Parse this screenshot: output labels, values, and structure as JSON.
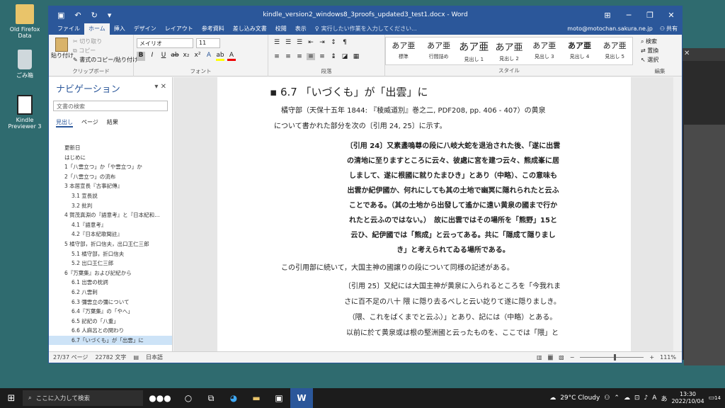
{
  "desktop": {
    "icons": [
      {
        "label": "Old Firefox Data"
      },
      {
        "label": "ごみ箱"
      },
      {
        "label": "Kindle Previewer 3"
      }
    ]
  },
  "window": {
    "title": "kindle_version2_windows8_3proofs_updated3_test1.docx - Word",
    "user": "moto@motochan.sakura.ne.jp",
    "share": "共有"
  },
  "tabs": [
    "ファイル",
    "ホーム",
    "挿入",
    "デザイン",
    "レイアウト",
    "参考資料",
    "差し込み文書",
    "校閲",
    "表示"
  ],
  "tell_me": "実行したい作業を入力してください...",
  "ribbon": {
    "clipboard": {
      "label": "クリップボード",
      "paste": "貼り付け",
      "cut": "切り取り",
      "copy": "コピー",
      "format_paint": "書式のコピー/貼り付け"
    },
    "font": {
      "label": "フォント",
      "name": "メイリオ",
      "size": "11"
    },
    "paragraph": {
      "label": "段落"
    },
    "styles": {
      "label": "スタイル",
      "items": [
        {
          "sample": "あア亜",
          "name": "標準"
        },
        {
          "sample": "あア亜",
          "name": "行間詰め"
        },
        {
          "sample": "あア亜",
          "name": "見出し 1"
        },
        {
          "sample": "あア亜",
          "name": "見出し 2"
        },
        {
          "sample": "あア亜",
          "name": "見出し 3"
        },
        {
          "sample": "あア亜",
          "name": "見出し 4"
        },
        {
          "sample": "あア亜",
          "name": "見出し 5"
        }
      ]
    },
    "editing": {
      "label": "編集",
      "find": "検索",
      "replace": "置換",
      "select": "選択"
    }
  },
  "nav": {
    "title": "ナビゲーション",
    "search_placeholder": "文書の検索",
    "tabs": [
      "見出し",
      "ページ",
      "結果"
    ],
    "items": [
      {
        "text": "更新日",
        "level": 1
      },
      {
        "text": "はじめに",
        "level": 1
      },
      {
        "text": "1「八雲立つ」か「や雲立つ」か",
        "level": 1
      },
      {
        "text": "2「八雲立つ」の流布",
        "level": 1
      },
      {
        "text": "3 本居宣長『古事記傳』",
        "level": 1
      },
      {
        "text": "3.1 宣長説",
        "level": 2
      },
      {
        "text": "3.2 批判",
        "level": 2
      },
      {
        "text": "4 賀茂真淵の『語意考』と『日本紀和…",
        "level": 1
      },
      {
        "text": "4.1『語意考』",
        "level": 2
      },
      {
        "text": "4.2『日本紀歌聞註』",
        "level": 2
      },
      {
        "text": "5 橘守部，折口信夫，出口王仁三郎",
        "level": 1
      },
      {
        "text": "5.1 橘守部，折口信夫",
        "level": 2
      },
      {
        "text": "5.2 出口王仁三郎",
        "level": 2
      },
      {
        "text": "6『万葉集』および記紀から",
        "level": 1
      },
      {
        "text": "6.1 出雲の枕詞",
        "level": 2
      },
      {
        "text": "6.2 八雲刺",
        "level": 2
      },
      {
        "text": "6.3 彌雲立の彌について",
        "level": 2
      },
      {
        "text": "6.4『万葉集』の「やへ」",
        "level": 2
      },
      {
        "text": "6.5 記紀の「八重」",
        "level": 2
      },
      {
        "text": "6.6 人麻呂との関わり",
        "level": 2
      },
      {
        "text": "6.7「いづくも」が「出雲」に",
        "level": 2,
        "selected": true
      }
    ]
  },
  "doc": {
    "heading": "6.7 「いづくも」が「出雲」に",
    "p1_l1": "橘守部（天保十五年 1844: 『稜威道別』巻之二, PDF208, pp. 406 - 407）の黄泉",
    "p1_l2": "について書かれた部分を次の〔引用 24, 25〕に示す。",
    "q24": [
      "〔引用 24〕又素盞嗚尊の段に八岐大蛇を退治された後、「遂に出雲",
      "の清地に至りますところに云々、彼處に宮を建つ云々、熊成峯に居",
      "しまして、遂に根國に就りたまひき」とあり（中略）、この意味も",
      "出雲か紀伊國か、何れにしても其の土地で幽冥に隠れられたと云ふ",
      "ことである。（其の土地から出發して遙かに遠い黄泉の國まで行か",
      "れたと云ふのではない。）　故に出雲ではその場所を「熊野」15と",
      "云ひ、紀伊國では「熊成」と云ってある。共に「隠成て隠りまし",
      "き」と考えられてゐる場所である。"
    ],
    "p2": "この引用部に続いて，大国主神の國譲りの段について同様の記述がある。",
    "q25": [
      "〔引用 25〕又紀には大国主神が黄泉に入られるところを「今我れま",
      "さに百不足の八十 隈 に隠り去るべしと云い訖りて遂に隠りましき。",
      "（隈、これをばくまでと云ふ）」とあり、記には（中略）とある。",
      "以前に於て黄泉或は根の堅洲國と云ったものを、ここでは「隈」と"
    ]
  },
  "status": {
    "page": "27/37 ページ",
    "words": "22782 文字",
    "lang": "日本語",
    "zoom": "111%"
  },
  "taskbar": {
    "search": "ここに入力して検索",
    "weather": "29°C Cloudy",
    "time": "13:30",
    "date": "2022/10/04",
    "ime": "あ",
    "notif": "14"
  }
}
